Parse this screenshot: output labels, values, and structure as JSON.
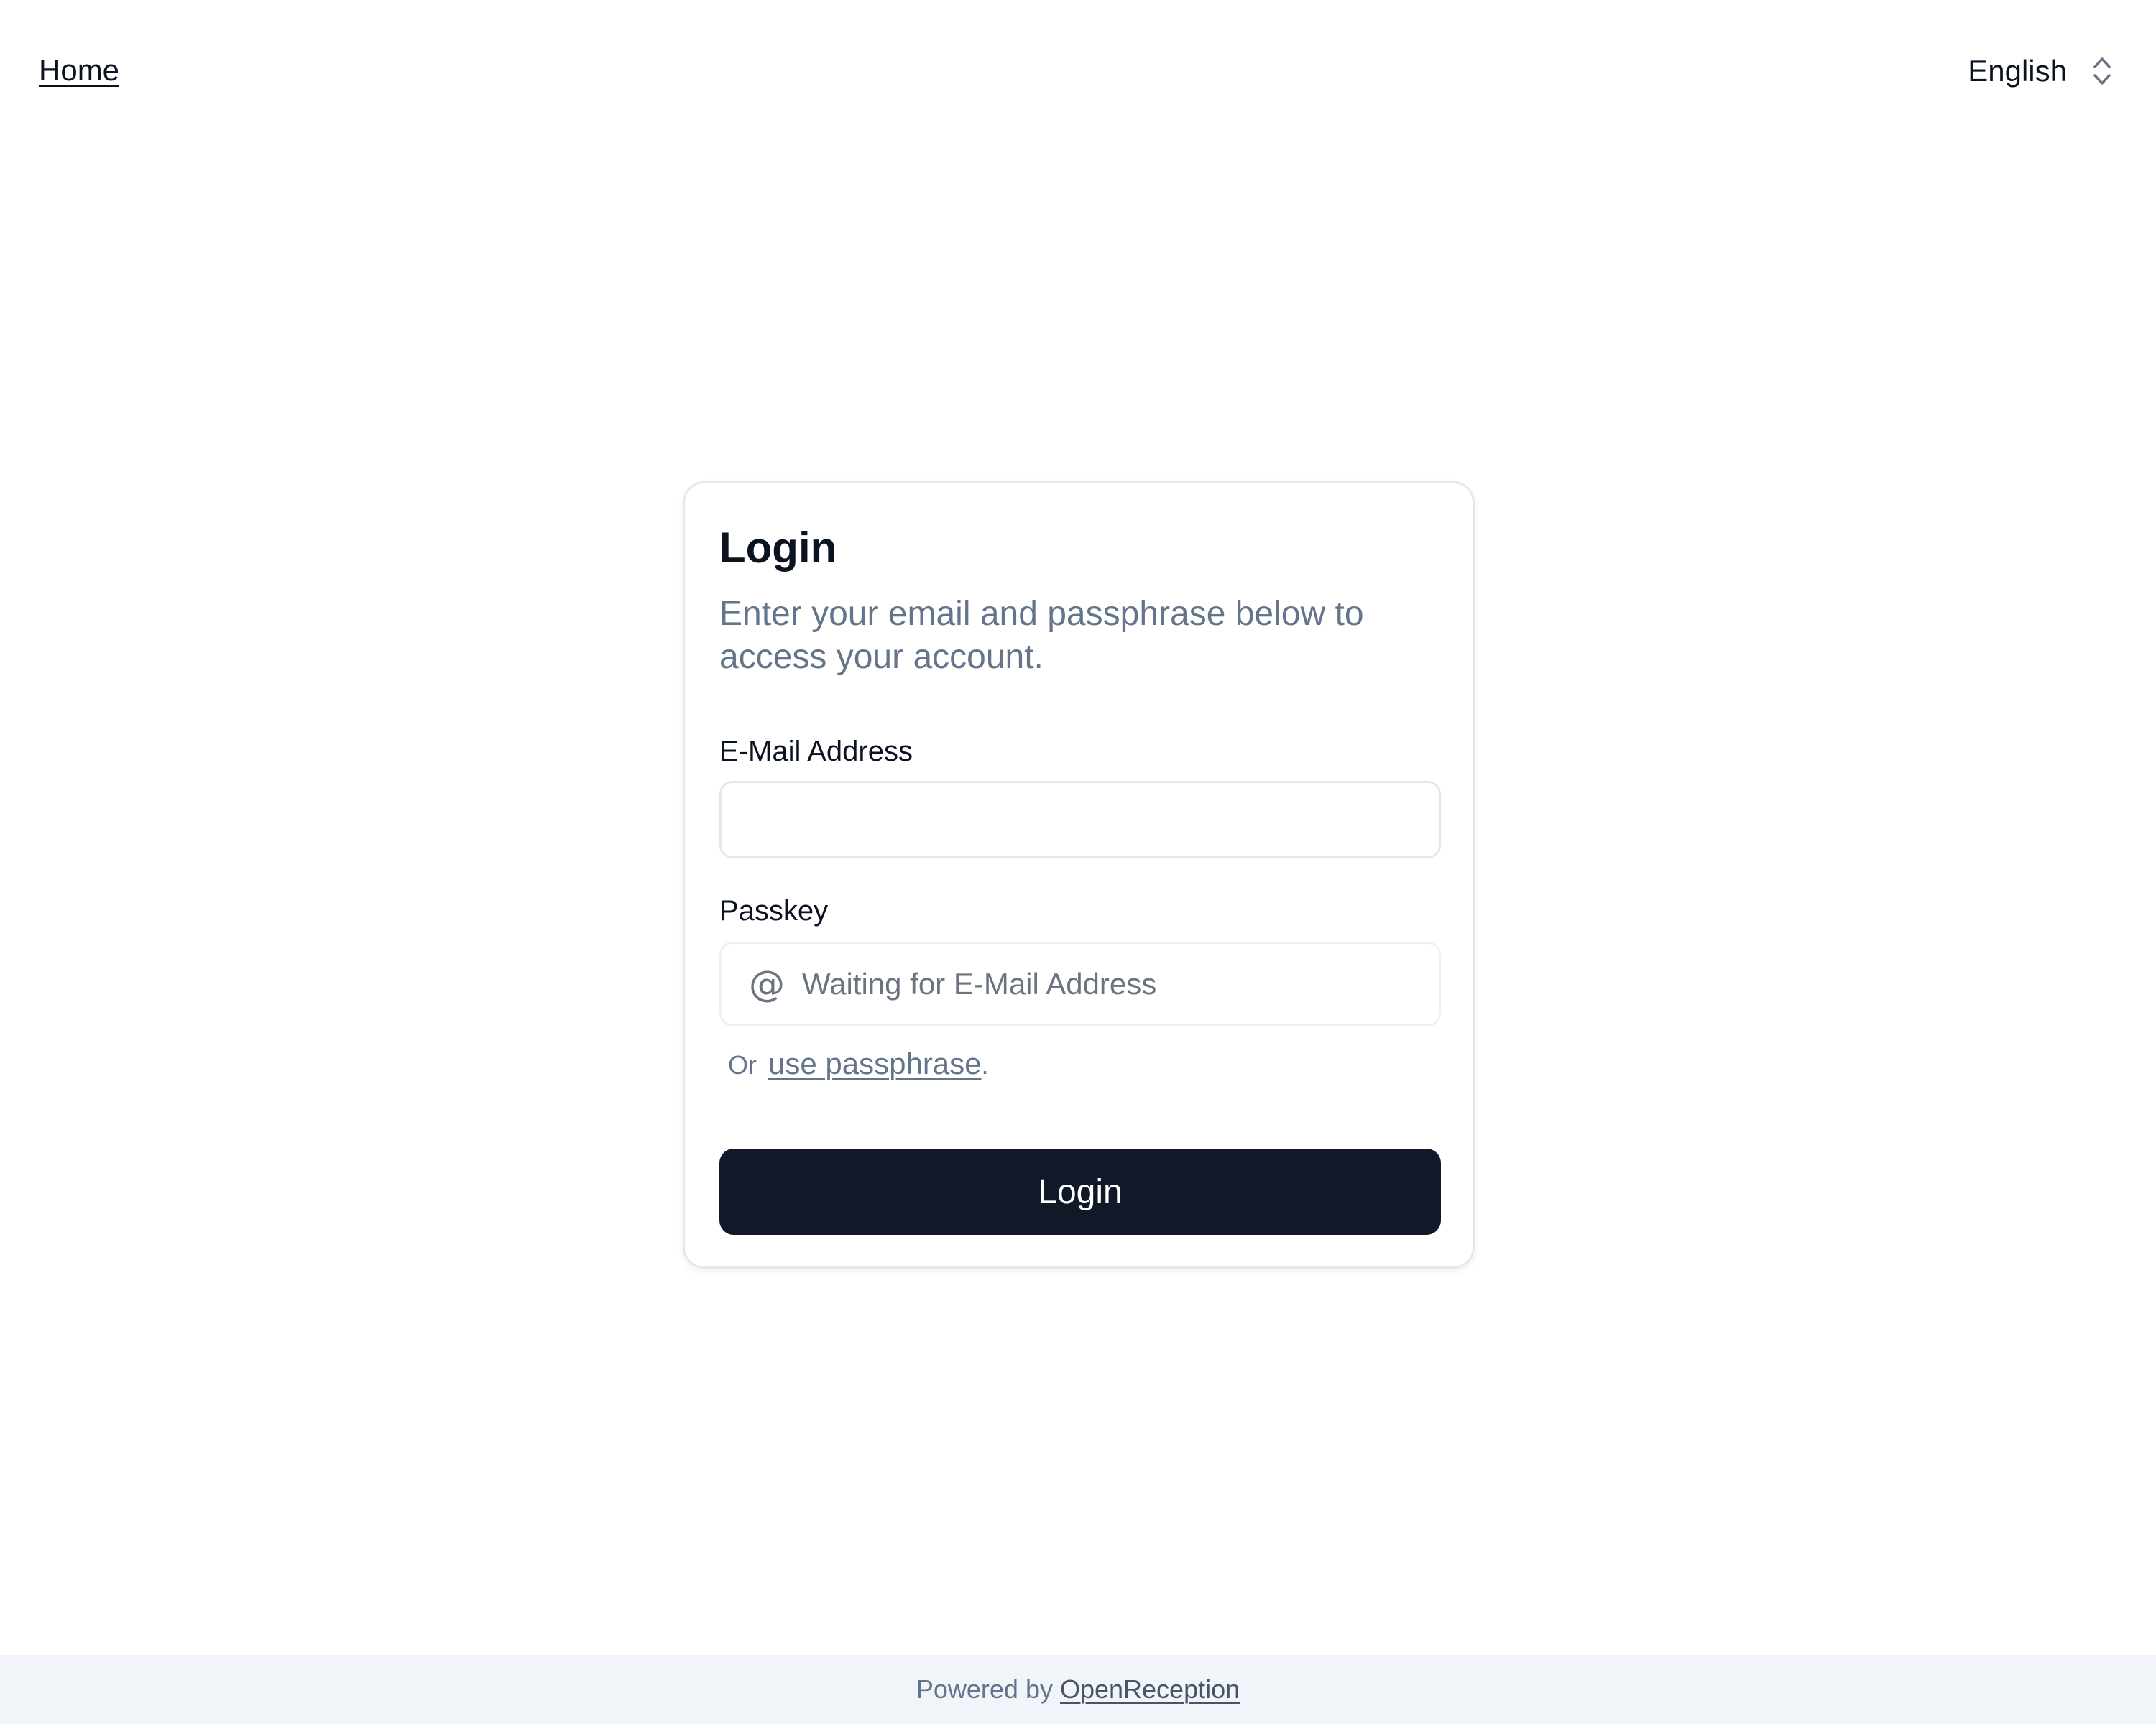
{
  "header": {
    "home_label": "Home",
    "language": {
      "selected": "English",
      "icon": "chevron-up-down-icon"
    }
  },
  "card": {
    "title": "Login",
    "description": "Enter your email and passphrase below to access your account.",
    "email_label": "E-Mail Address",
    "email_value": "",
    "passkey_label": "Passkey",
    "passkey_icon": "at-sign-icon",
    "passkey_placeholder": "Waiting for E-Mail Address",
    "alt_prefix": "Or",
    "alt_link": "use passphrase",
    "alt_suffix": ".",
    "submit_label": "Login"
  },
  "footer": {
    "powered_by": "Powered by",
    "link_label": "OpenReception"
  },
  "colors": {
    "primary_button": "#111827",
    "muted_text": "#64748b",
    "border": "#e2e8f0",
    "footer_bg": "#f1f5f9"
  }
}
